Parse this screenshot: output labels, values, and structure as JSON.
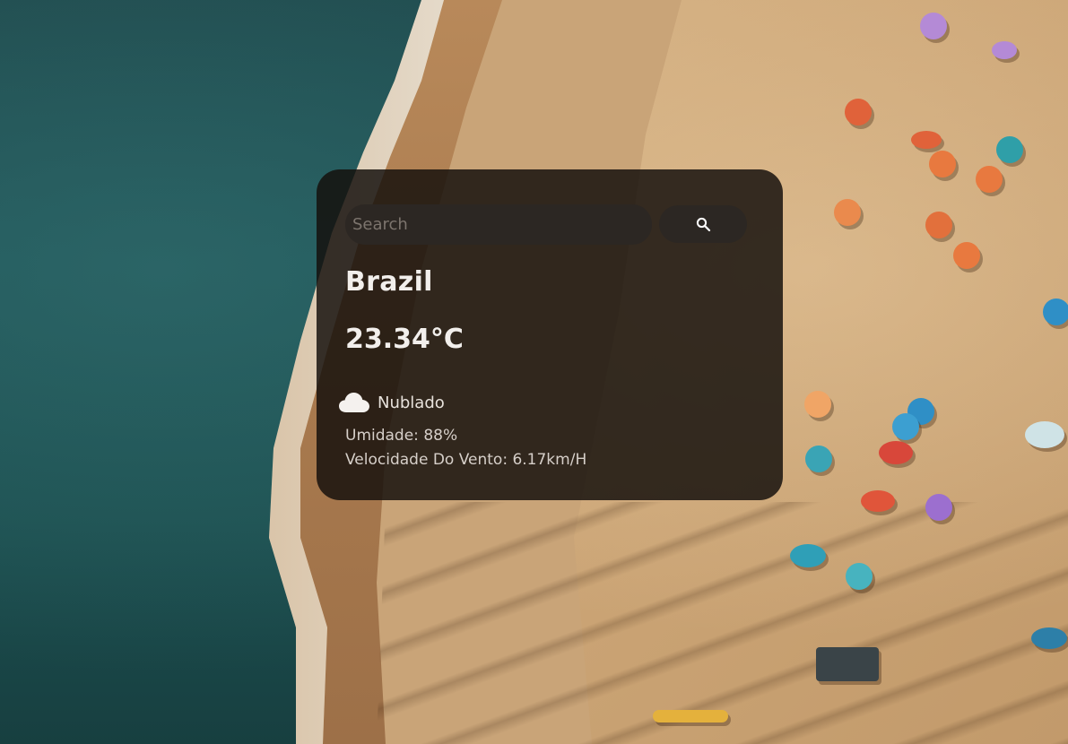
{
  "search": {
    "placeholder": "Search",
    "value": ""
  },
  "weather": {
    "city": "Brazil",
    "temperature": "23.34°C",
    "condition": "Nublado",
    "humidity": "Umidade: 88%",
    "wind": "Velocidade Do Vento: 6.17km/H"
  },
  "icons": {
    "search_button": "search-icon",
    "condition": "cloud-icon"
  },
  "colors": {
    "card_background": "#140f0c",
    "input_background": "#2c2723",
    "text_primary": "#f2efec",
    "text_secondary": "#d6cfc9"
  }
}
